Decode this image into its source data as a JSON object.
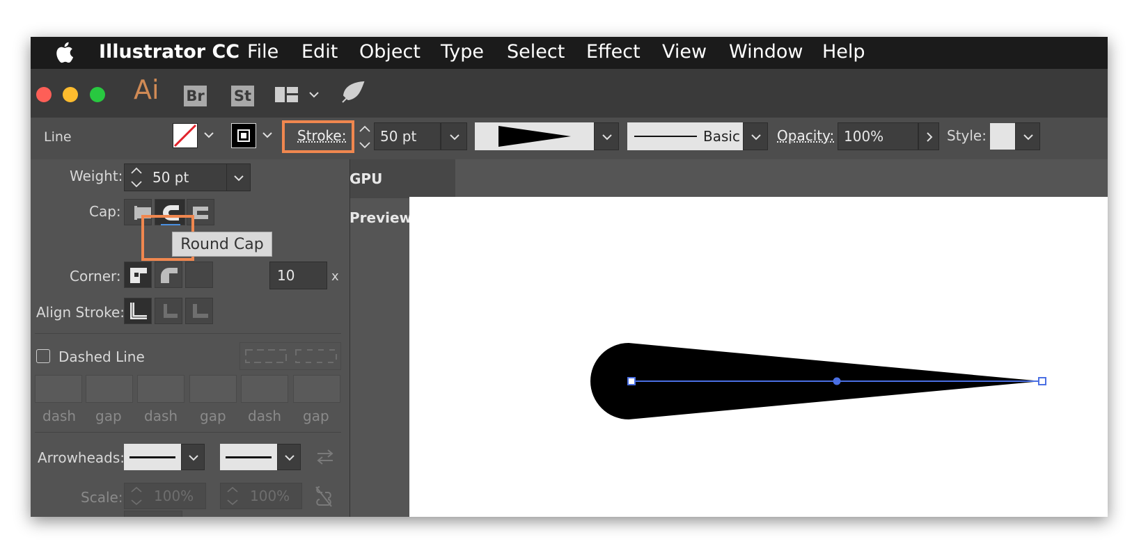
{
  "menubar": {
    "apple_icon": "apple-icon",
    "app_name": "Illustrator CC",
    "items": [
      "File",
      "Edit",
      "Object",
      "Type",
      "Select",
      "Effect",
      "View",
      "Window",
      "Help"
    ]
  },
  "appbar": {
    "logo": "Ai",
    "bridge": "Br",
    "stock": "St",
    "icons": [
      "workspace-icon",
      "chevron-down-icon",
      "sync-icon"
    ]
  },
  "control": {
    "object_type": "Line",
    "stroke_label": "Stroke:",
    "stroke_weight": "50 pt",
    "profile_label": "Basic",
    "opacity_label": "Opacity:",
    "opacity_value": "100%",
    "style_label": "Style:"
  },
  "document_tab": "GPU Preview)",
  "stroke_panel": {
    "weight_label": "Weight:",
    "weight_value": "50 pt",
    "cap_label": "Cap:",
    "corner_label": "Corner:",
    "limit_value": "10",
    "limit_suffix": "x",
    "align_label": "Align Stroke:",
    "dashed_label": "Dashed Line",
    "dash_labels": [
      "dash",
      "gap",
      "dash",
      "gap",
      "dash",
      "gap"
    ],
    "arrowheads_label": "Arrowheads:",
    "scale_label": "Scale:",
    "scale_value_1": "100%",
    "scale_value_2": "100%"
  },
  "tooltip": "Round Cap",
  "colors": {
    "highlight": "#f0874f",
    "selection": "#4a6fe3",
    "traffic_red": "#fe5f57",
    "traffic_yellow": "#febc2e",
    "traffic_green": "#28c840",
    "logo": "#d08a55"
  }
}
